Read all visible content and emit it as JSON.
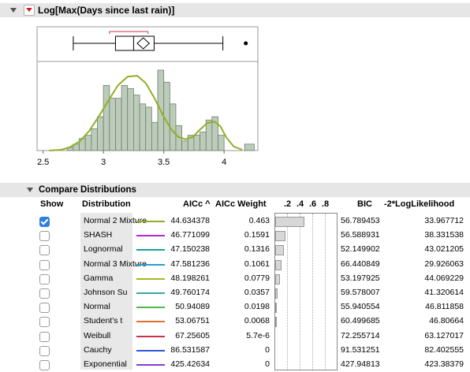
{
  "report": {
    "title": "Log[Max(Days since last rain)]"
  },
  "chart_data": {
    "type": "histogram",
    "x_ticks": [
      "2.5",
      "3",
      "3.5",
      "4"
    ],
    "xlim": [
      2.45,
      4.28
    ],
    "bins": [
      {
        "x0": 2.7,
        "x1": 2.75,
        "height": 0.04
      },
      {
        "x0": 2.75,
        "x1": 2.8,
        "height": 0.08
      },
      {
        "x0": 2.8,
        "x1": 2.85,
        "height": 0.15
      },
      {
        "x0": 2.85,
        "x1": 2.9,
        "height": 0.19
      },
      {
        "x0": 2.9,
        "x1": 2.95,
        "height": 0.27
      },
      {
        "x0": 2.95,
        "x1": 3.0,
        "height": 0.42
      },
      {
        "x0": 3.0,
        "x1": 3.05,
        "height": 0.81
      },
      {
        "x0": 3.05,
        "x1": 3.1,
        "height": 0.65
      },
      {
        "x0": 3.1,
        "x1": 3.15,
        "height": 0.65
      },
      {
        "x0": 3.15,
        "x1": 3.2,
        "height": 0.81
      },
      {
        "x0": 3.2,
        "x1": 3.25,
        "height": 0.77
      },
      {
        "x0": 3.25,
        "x1": 3.3,
        "height": 0.69
      },
      {
        "x0": 3.3,
        "x1": 3.35,
        "height": 0.58
      },
      {
        "x0": 3.35,
        "x1": 3.4,
        "height": 0.54
      },
      {
        "x0": 3.4,
        "x1": 3.45,
        "height": 0.35
      },
      {
        "x0": 3.45,
        "x1": 3.5,
        "height": 1.0
      },
      {
        "x0": 3.5,
        "x1": 3.55,
        "height": 0.85
      },
      {
        "x0": 3.55,
        "x1": 3.6,
        "height": 0.58
      },
      {
        "x0": 3.6,
        "x1": 3.65,
        "height": 0.31
      },
      {
        "x0": 3.65,
        "x1": 3.7,
        "height": 0.12
      },
      {
        "x0": 3.7,
        "x1": 3.75,
        "height": 0.19
      },
      {
        "x0": 3.75,
        "x1": 3.8,
        "height": 0.19
      },
      {
        "x0": 3.8,
        "x1": 3.85,
        "height": 0.23
      },
      {
        "x0": 3.85,
        "x1": 3.9,
        "height": 0.38
      },
      {
        "x0": 3.9,
        "x1": 3.95,
        "height": 0.42
      },
      {
        "x0": 3.95,
        "x1": 4.0,
        "height": 0.19
      },
      {
        "x0": 4.17,
        "x1": 4.25,
        "height": 0.08
      }
    ],
    "fit_curve": {
      "name": "Normal 2 Mixture",
      "x": [
        2.55,
        2.65,
        2.72,
        2.8,
        2.88,
        2.96,
        3.04,
        3.12,
        3.2,
        3.28,
        3.35,
        3.42,
        3.5,
        3.56,
        3.62,
        3.68,
        3.74,
        3.8,
        3.86,
        3.92,
        3.97,
        4.02,
        4.08,
        4.15
      ],
      "y": [
        0.0,
        0.01,
        0.04,
        0.11,
        0.24,
        0.42,
        0.62,
        0.81,
        0.92,
        0.93,
        0.84,
        0.66,
        0.42,
        0.27,
        0.17,
        0.14,
        0.17,
        0.26,
        0.34,
        0.36,
        0.3,
        0.16,
        0.05,
        0.01
      ]
    },
    "boxplot": {
      "whisker_low": 2.75,
      "q1": 3.1,
      "median": 3.25,
      "q3": 3.42,
      "whisker_high": 3.99,
      "mean": 3.33,
      "mean_diamond_low": 3.28,
      "mean_diamond_high": 3.38,
      "shortest_half_low": 3.05,
      "shortest_half_high": 3.37,
      "outliers": [
        4.18
      ]
    },
    "colors": {
      "bar_fill": "#bccbba",
      "bar_stroke": "#6f7f6d",
      "curve": "#8eb021",
      "shortest_half": "#c8324b"
    }
  },
  "compare": {
    "title": "Compare Distributions",
    "headers": {
      "show": "Show",
      "distribution": "Distribution",
      "aicc": "AICc",
      "aicc_sort": "^",
      "aicc_weight": "AICc Weight",
      "scale": [
        ".2",
        ".4",
        ".6",
        ".8"
      ],
      "bic": "BIC",
      "loglik": "-2*LogLikelihood"
    },
    "rows": [
      {
        "checked": true,
        "name": "Normal 2 Mixture",
        "color": "#8eb021",
        "aicc": "44.634378",
        "weight": "0.463",
        "weight_value": 0.463,
        "bic": "56.789453",
        "loglik": "33.967712"
      },
      {
        "checked": false,
        "name": "SHASH",
        "color": "#b02ad0",
        "aicc": "46.771099",
        "weight": "0.1591",
        "weight_value": 0.1591,
        "bic": "56.588931",
        "loglik": "38.331538"
      },
      {
        "checked": false,
        "name": "Lognormal",
        "color": "#1aa0a0",
        "aicc": "47.150238",
        "weight": "0.1316",
        "weight_value": 0.1316,
        "bic": "52.149902",
        "loglik": "43.021205"
      },
      {
        "checked": false,
        "name": "Normal 3 Mixture",
        "color": "#2a9ad6",
        "aicc": "47.581236",
        "weight": "0.1061",
        "weight_value": 0.1061,
        "bic": "66.440849",
        "loglik": "29.926063"
      },
      {
        "checked": false,
        "name": "Gamma",
        "color": "#a8b81e",
        "aicc": "48.198261",
        "weight": "0.0779",
        "weight_value": 0.0779,
        "bic": "53.197925",
        "loglik": "44.069229"
      },
      {
        "checked": false,
        "name": "Johnson Su",
        "color": "#3aa8a0",
        "aicc": "49.760174",
        "weight": "0.0357",
        "weight_value": 0.0357,
        "bic": "59.578007",
        "loglik": "41.320614"
      },
      {
        "checked": false,
        "name": "Normal",
        "color": "#4cba4c",
        "aicc": "50.94089",
        "weight": "0.0198",
        "weight_value": 0.0198,
        "bic": "55.940554",
        "loglik": "46.811858"
      },
      {
        "checked": false,
        "name": "Student's t",
        "color": "#e0702a",
        "aicc": "53.06751",
        "weight": "0.0068",
        "weight_value": 0.0068,
        "bic": "60.499685",
        "loglik": "46.80664"
      },
      {
        "checked": false,
        "name": "Weibull",
        "color": "#c8324b",
        "aicc": "67.25605",
        "weight": "5.7e-6",
        "weight_value": 5.7e-06,
        "bic": "72.255714",
        "loglik": "63.127017"
      },
      {
        "checked": false,
        "name": "Cauchy",
        "color": "#2a5ad6",
        "aicc": "86.531587",
        "weight": "0",
        "weight_value": 0,
        "bic": "91.531251",
        "loglik": "82.402555"
      },
      {
        "checked": false,
        "name": "Exponential",
        "color": "#8a3ad0",
        "aicc": "425.42634",
        "weight": "0",
        "weight_value": 0,
        "bic": "427.94813",
        "loglik": "423.38379"
      }
    ]
  }
}
